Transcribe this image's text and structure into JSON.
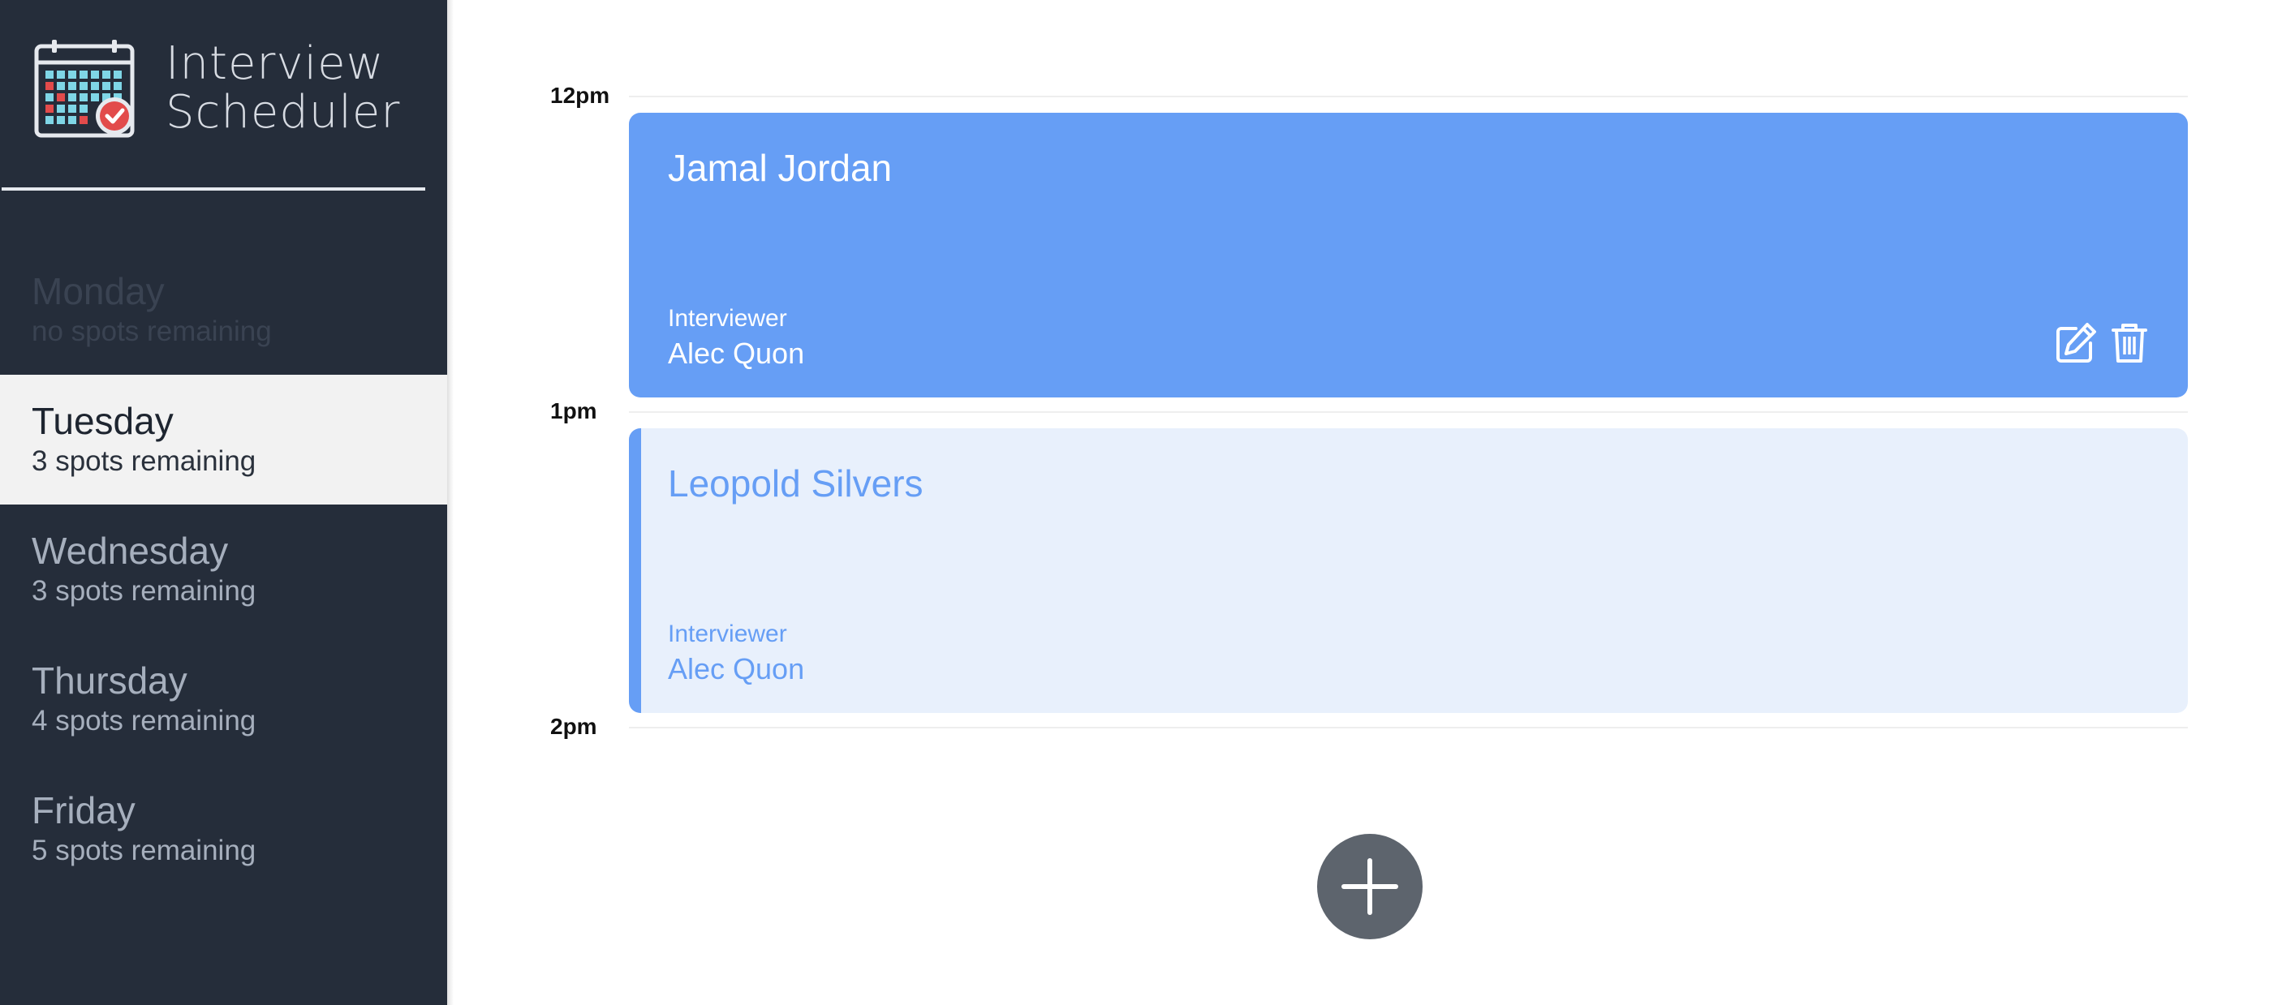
{
  "app": {
    "title_line1": "Interview",
    "title_line2": "Scheduler",
    "logo_icon": "calendar-check-icon"
  },
  "sidebar": {
    "days": [
      {
        "name": "Monday",
        "spots": "no spots remaining",
        "state": "full"
      },
      {
        "name": "Tuesday",
        "spots": "3 spots remaining",
        "state": "selected"
      },
      {
        "name": "Wednesday",
        "spots": "3 spots remaining",
        "state": "default"
      },
      {
        "name": "Thursday",
        "spots": "4 spots remaining",
        "state": "default"
      },
      {
        "name": "Friday",
        "spots": "5 spots remaining",
        "state": "default"
      }
    ]
  },
  "schedule": {
    "times": [
      "12pm",
      "1pm",
      "2pm"
    ],
    "appointments": [
      {
        "student": "Jamal Jordan",
        "interviewer_label": "Interviewer",
        "interviewer": "Alec Quon",
        "style": "highlighted",
        "actions": [
          "edit-icon",
          "trash-icon"
        ]
      },
      {
        "student": "Leopold Silvers",
        "interviewer_label": "Interviewer",
        "interviewer": "Alec Quon",
        "style": "default"
      }
    ],
    "add_icon": "plus-icon"
  },
  "colors": {
    "sidebar_bg": "#252d3a",
    "accent": "#669ef5",
    "appointment_light": "#e8f0fc",
    "selected_day_bg": "#f2f2f2",
    "add_button": "#5d646d"
  }
}
